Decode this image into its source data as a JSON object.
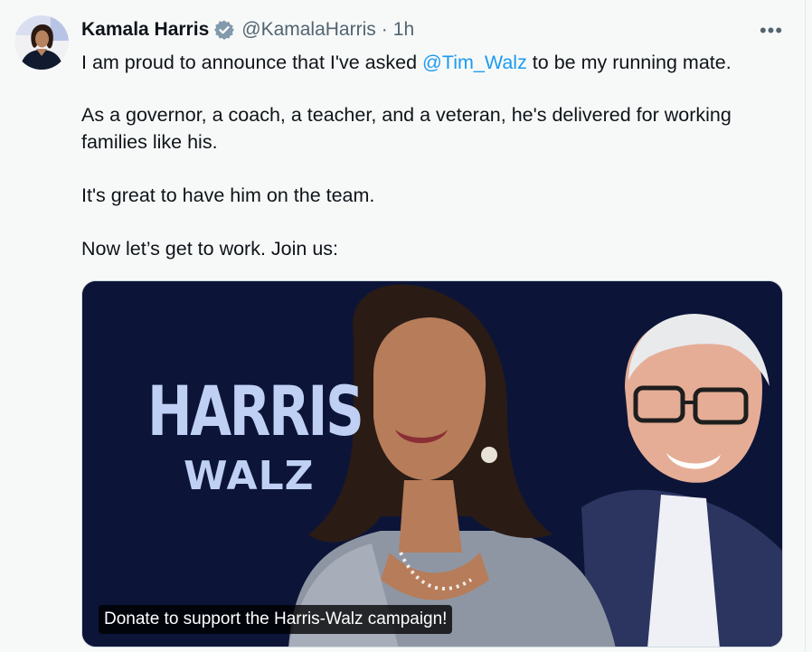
{
  "author": {
    "name": "Kamala Harris",
    "handle": "@KamalaHarris",
    "separator": "·",
    "time": "1h",
    "verified_icon": "verified-badge-icon"
  },
  "more_icon": "more-options-icon",
  "more_label": "•••",
  "tweet": {
    "line1_before": "I am proud to announce that I've asked ",
    "mention": "@Tim_Walz",
    "line1_after": " to be my running mate.",
    "line2": "As a governor, a coach, a teacher, and a veteran, he's delivered for working",
    "line3": "families like his.",
    "line4": "It's great to have him on the team.",
    "line5": "Now let’s get to work. Join us:"
  },
  "media": {
    "brand_line1": "HARRIS",
    "brand_line2": "WALZ",
    "caption": "Donate to support the Harris-Walz campaign!",
    "background_color": "#0c1538",
    "brand_color": "#bfd0f4"
  },
  "colors": {
    "accent": "#1d9bf0",
    "text": "#0f1419",
    "secondary": "#536471",
    "verified_badge": "#829aab"
  }
}
